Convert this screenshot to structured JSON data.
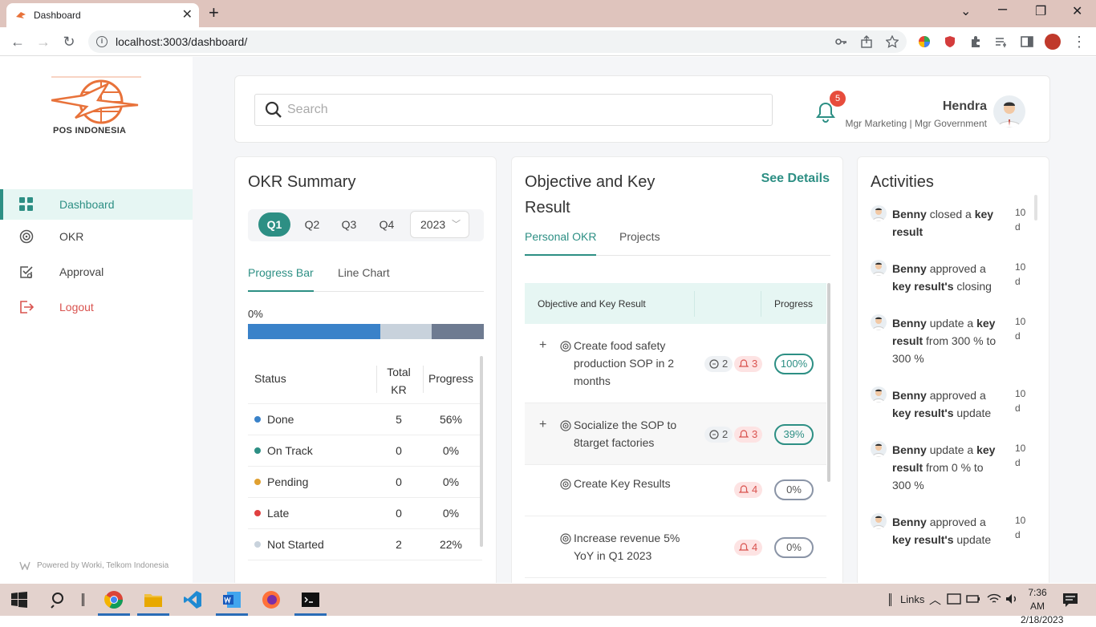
{
  "browser": {
    "tab_title": "Dashboard",
    "url": "localhost:3003/dashboard/"
  },
  "sidebar": {
    "logo_text": "POS INDONESIA",
    "items": [
      {
        "label": "Dashboard",
        "icon": "grid-icon",
        "active": true
      },
      {
        "label": "OKR",
        "icon": "target-icon"
      },
      {
        "label": "Approval",
        "icon": "approval-check-icon"
      },
      {
        "label": "Logout",
        "icon": "logout-icon"
      }
    ],
    "powered_by": "Powered by Worki, Telkom Indonesia"
  },
  "header": {
    "search_placeholder": "Search",
    "notification_count": "5",
    "user_name": "Hendra",
    "user_role": "Mgr Marketing | Mgr Government"
  },
  "okr_summary": {
    "title": "OKR Summary",
    "quarters": [
      "Q1",
      "Q2",
      "Q3",
      "Q4"
    ],
    "active_quarter": "Q1",
    "year": "2023",
    "tabs": [
      "Progress Bar",
      "Line Chart"
    ],
    "progress_label": "0%",
    "progress_segments": [
      {
        "fraction": 0.56,
        "color": "#3a82c9"
      },
      {
        "fraction": 0.22,
        "color": "#c8d2dc"
      },
      {
        "fraction": 0.22,
        "color": "#6e7b91"
      }
    ],
    "table_headers": {
      "status": "Status",
      "total_kr_1": "Total",
      "total_kr_2": "KR",
      "progress": "Progress"
    },
    "rows": [
      {
        "status": "Done",
        "color": "#3a82c9",
        "total": "5",
        "progress": "56%"
      },
      {
        "status": "On Track",
        "color": "#2d8f84",
        "total": "0",
        "progress": "0%"
      },
      {
        "status": "Pending",
        "color": "#e0a030",
        "total": "0",
        "progress": "0%"
      },
      {
        "status": "Late",
        "color": "#e04040",
        "total": "0",
        "progress": "0%"
      },
      {
        "status": "Not Started",
        "color": "#c8d2dc",
        "total": "2",
        "progress": "22%"
      }
    ]
  },
  "objectives": {
    "title_1": "Objective and Key",
    "title_2": "Result",
    "see_details": "See Details",
    "tabs": [
      "Personal OKR",
      "Projects"
    ],
    "header_col": "Objective and Key Result",
    "header_progress": "Progress",
    "rows": [
      {
        "lines": [
          "Create food safety",
          "production SOP in 2",
          "months"
        ],
        "comments": "2",
        "alerts": "3",
        "progress": "100%",
        "expandable": true
      },
      {
        "lines": [
          "Socialize the SOP to",
          "8target factories"
        ],
        "comments": "2",
        "alerts": "3",
        "progress": "39%",
        "expandable": true
      },
      {
        "lines": [
          "Create Key Results"
        ],
        "alerts": "4",
        "progress": "0%",
        "expandable": false
      },
      {
        "lines": [
          "Increase revenue 5%",
          "YoY in Q1 2023"
        ],
        "alerts": "4",
        "progress": "0%",
        "expandable": false
      }
    ]
  },
  "activities": {
    "title": "Activities",
    "items": [
      {
        "user": "Benny",
        "lines": [
          [
            "closed a ",
            "key"
          ],
          [
            "result"
          ]
        ],
        "time": [
          "10",
          "d"
        ]
      },
      {
        "user": "Benny",
        "lines": [
          [
            "approved a"
          ],
          [
            "key result's",
            " closing"
          ]
        ],
        "time": [
          "10",
          "d"
        ]
      },
      {
        "user": "Benny",
        "lines": [
          [
            "update a ",
            "key"
          ],
          [
            "result",
            " from 300 % to"
          ],
          [
            "300 %"
          ]
        ],
        "time": [
          "10",
          "d"
        ]
      },
      {
        "user": "Benny",
        "lines": [
          [
            "approved a"
          ],
          [
            "key result's",
            " update"
          ]
        ],
        "time": [
          "10",
          "d"
        ]
      },
      {
        "user": "Benny",
        "lines": [
          [
            "update a ",
            "key"
          ],
          [
            "result",
            " from 0 % to"
          ],
          [
            "300 %"
          ]
        ],
        "time": [
          "10",
          "d"
        ]
      },
      {
        "user": "Benny",
        "lines": [
          [
            "approved a"
          ],
          [
            "key result's",
            " update"
          ]
        ],
        "time": [
          "10",
          "d"
        ]
      }
    ]
  },
  "taskbar": {
    "links_label": "Links",
    "time": "7:36 AM",
    "date": "2/18/2023"
  }
}
